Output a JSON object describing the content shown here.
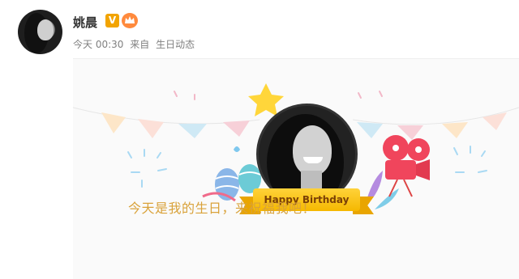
{
  "post": {
    "username": "姚晨",
    "verified_badge": "V",
    "badges": [
      "verified-icon",
      "crown-icon"
    ],
    "time": "今天 00:30",
    "source_prefix": "来自",
    "source": "生日动态"
  },
  "card": {
    "banner_text": "Happy Birthday",
    "message": "今天是我的生日，来祝福我吧！",
    "colors": {
      "accent": "#d9a23a",
      "banner": "#f5b800",
      "star": "#ffd63a",
      "projector": "#f0455c"
    }
  }
}
